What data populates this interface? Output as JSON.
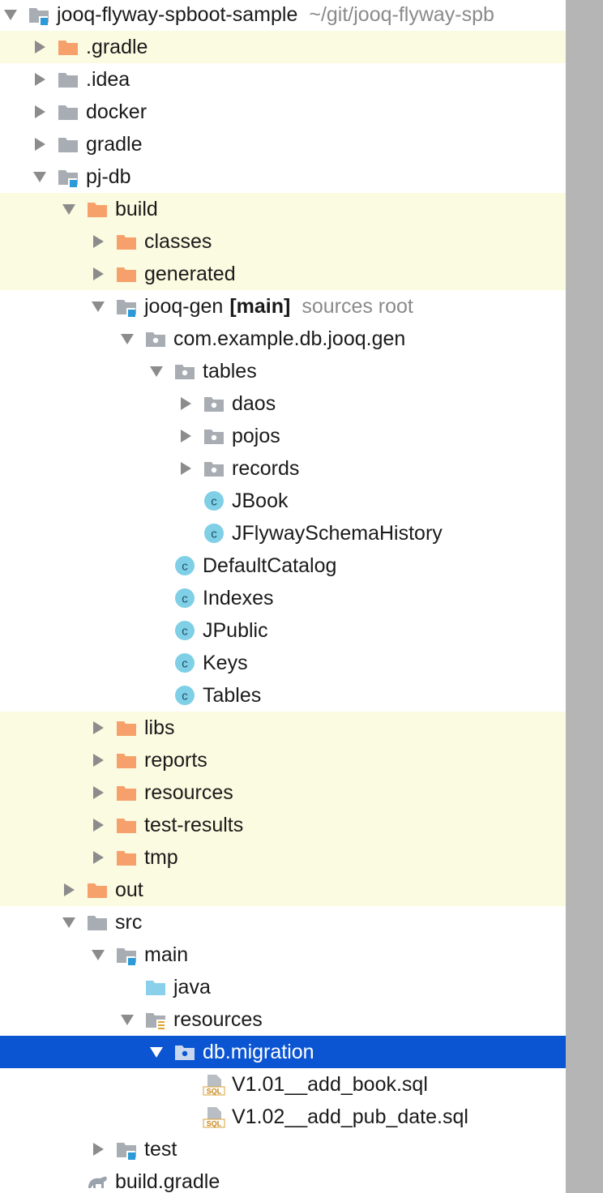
{
  "colors": {
    "excluded_row_bg": "#fbfbe1",
    "selection_bg": "#0b55d2",
    "orange_folder": "#f6a16c",
    "grey_folder": "#a7adb3",
    "source_folder": "#8ad0ea",
    "class_icon": "#7fcfe6",
    "module_badge": "#2a9ad8",
    "scrollbar": "#b5b5b5"
  },
  "tree": {
    "rows": [
      {
        "label": "jooq-flyway-spboot-sample",
        "suffix": "~/git/jooq-flyway-spb",
        "icon": "module-folder-icon",
        "arrow": "down",
        "depth": 0,
        "highlight": false
      },
      {
        "label": ".gradle",
        "icon": "excluded-folder-icon",
        "arrow": "right",
        "depth": 1,
        "highlight": true
      },
      {
        "label": ".idea",
        "icon": "folder-icon",
        "arrow": "right",
        "depth": 1,
        "highlight": false
      },
      {
        "label": "docker",
        "icon": "folder-icon",
        "arrow": "right",
        "depth": 1,
        "highlight": false
      },
      {
        "label": "gradle",
        "icon": "folder-icon",
        "arrow": "right",
        "depth": 1,
        "highlight": false
      },
      {
        "label": "pj-db",
        "icon": "module-folder-icon",
        "arrow": "down",
        "depth": 1,
        "highlight": false
      },
      {
        "label": "build",
        "icon": "excluded-folder-icon",
        "arrow": "down",
        "depth": 2,
        "highlight": true
      },
      {
        "label": "classes",
        "icon": "excluded-folder-icon",
        "arrow": "right",
        "depth": 3,
        "highlight": true
      },
      {
        "label": "generated",
        "icon": "excluded-folder-icon",
        "arrow": "right",
        "depth": 3,
        "highlight": true
      },
      {
        "label": "jooq-gen",
        "tag": "[main]",
        "suffix": "sources root",
        "icon": "module-folder-icon",
        "arrow": "down",
        "depth": 3,
        "highlight": false
      },
      {
        "label": "com.example.db.jooq.gen",
        "icon": "package-icon",
        "arrow": "down",
        "depth": 4,
        "highlight": false
      },
      {
        "label": "tables",
        "icon": "package-icon",
        "arrow": "down",
        "depth": 5,
        "highlight": false
      },
      {
        "label": "daos",
        "icon": "package-icon",
        "arrow": "right",
        "depth": 6,
        "highlight": false
      },
      {
        "label": "pojos",
        "icon": "package-icon",
        "arrow": "right",
        "depth": 6,
        "highlight": false
      },
      {
        "label": "records",
        "icon": "package-icon",
        "arrow": "right",
        "depth": 6,
        "highlight": false
      },
      {
        "label": "JBook",
        "icon": "class-icon",
        "arrow": "none",
        "depth": 6,
        "highlight": false
      },
      {
        "label": "JFlywaySchemaHistory",
        "icon": "class-icon",
        "arrow": "none",
        "depth": 6,
        "highlight": false
      },
      {
        "label": "DefaultCatalog",
        "icon": "class-icon",
        "arrow": "none",
        "depth": 5,
        "highlight": false
      },
      {
        "label": "Indexes",
        "icon": "class-icon",
        "arrow": "none",
        "depth": 5,
        "highlight": false
      },
      {
        "label": "JPublic",
        "icon": "class-icon",
        "arrow": "none",
        "depth": 5,
        "highlight": false
      },
      {
        "label": "Keys",
        "icon": "class-icon",
        "arrow": "none",
        "depth": 5,
        "highlight": false
      },
      {
        "label": "Tables",
        "icon": "class-icon",
        "arrow": "none",
        "depth": 5,
        "highlight": false
      },
      {
        "label": "libs",
        "icon": "excluded-folder-icon",
        "arrow": "right",
        "depth": 3,
        "highlight": true
      },
      {
        "label": "reports",
        "icon": "excluded-folder-icon",
        "arrow": "right",
        "depth": 3,
        "highlight": true
      },
      {
        "label": "resources",
        "icon": "excluded-folder-icon",
        "arrow": "right",
        "depth": 3,
        "highlight": true
      },
      {
        "label": "test-results",
        "icon": "excluded-folder-icon",
        "arrow": "right",
        "depth": 3,
        "highlight": true
      },
      {
        "label": "tmp",
        "icon": "excluded-folder-icon",
        "arrow": "right",
        "depth": 3,
        "highlight": true
      },
      {
        "label": "out",
        "icon": "excluded-folder-icon",
        "arrow": "right",
        "depth": 2,
        "highlight": true
      },
      {
        "label": "src",
        "icon": "folder-icon",
        "arrow": "down",
        "depth": 2,
        "highlight": false
      },
      {
        "label": "main",
        "icon": "module-folder-icon",
        "arrow": "down",
        "depth": 3,
        "highlight": false
      },
      {
        "label": "java",
        "icon": "source-folder-icon",
        "arrow": "none",
        "depth": 4,
        "highlight": false
      },
      {
        "label": "resources",
        "icon": "resources-folder-icon",
        "arrow": "down",
        "depth": 4,
        "highlight": false
      },
      {
        "label": "db.migration",
        "icon": "package-icon",
        "arrow": "down",
        "depth": 5,
        "highlight": false,
        "selected": true
      },
      {
        "label": "V1.01__add_book.sql",
        "icon": "sql-file-icon",
        "arrow": "none",
        "depth": 6,
        "highlight": false
      },
      {
        "label": "V1.02__add_pub_date.sql",
        "icon": "sql-file-icon",
        "arrow": "none",
        "depth": 6,
        "highlight": false
      },
      {
        "label": "test",
        "icon": "module-folder-icon",
        "arrow": "right",
        "depth": 3,
        "highlight": false
      },
      {
        "label": "build.gradle",
        "icon": "gradle-file-icon",
        "arrow": "none",
        "depth": 2,
        "highlight": false
      }
    ]
  }
}
